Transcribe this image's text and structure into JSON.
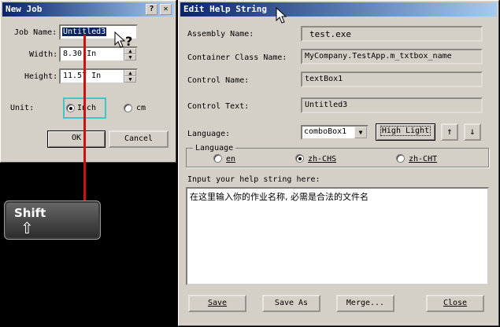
{
  "new_job": {
    "title": "New Job",
    "help_btn": "?",
    "close_btn": "✕",
    "job_name_label": "Job Name:",
    "job_name_value": "Untitled3",
    "width_label": "Width:",
    "width_value": "8.30 In",
    "height_label": "Height:",
    "height_value": "11.57 In",
    "unit_label": "Unit:",
    "unit_inch": "Inch",
    "unit_cm": "cm",
    "ok_label": "OK",
    "cancel_label": "Cancel"
  },
  "key": {
    "label": "Shift",
    "arrow": "⇧"
  },
  "edit_help": {
    "title": "Edit Help String",
    "assembly_label": "Assembly Name:",
    "assembly_value": "test.exe",
    "container_label": "Container Class Name:",
    "container_value": "MyCompany.TestApp.m_txtbox_name",
    "control_name_label": "Control Name:",
    "control_name_value": "textBox1",
    "control_text_label": "Control Text:",
    "control_text_value": "Untitled3",
    "language_label": "Language:",
    "language_value": "comboBox1",
    "highlight_label": "High Light",
    "up_arrow": "↑",
    "down_arrow": "↓",
    "lang_group_label": "Language",
    "lang_en": "en",
    "lang_zh_chs": "zh-CHS",
    "lang_zh_cht": "zh-CHT",
    "selected_lang": "zh-CHS",
    "help_input_label": "Input your help string here:",
    "help_text": "在这里输入你的作业名称, 必需是合法的文件名",
    "save_label": "Save",
    "save_as_label": "Save As",
    "merge_label": "Merge...",
    "close_label": "Close"
  }
}
